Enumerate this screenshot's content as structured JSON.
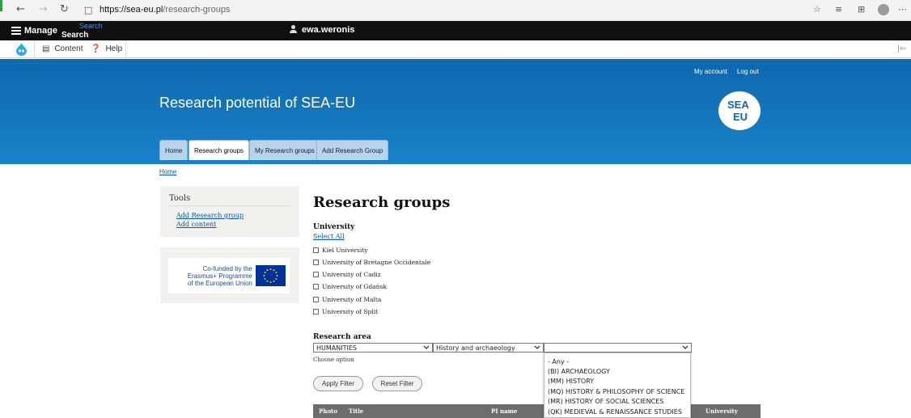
{
  "browser": {
    "back_icon": "←",
    "forward_icon": "→",
    "reload_icon": "↻",
    "page_icon": "□",
    "url_host": "https://sea-eu.pl",
    "url_path": "/research-groups",
    "right_icons": [
      "☆",
      "≡",
      "⊞",
      "⋯"
    ]
  },
  "toolbar": {
    "manage_label": "Manage",
    "search_label": "Search",
    "search_ghost": "Search",
    "username": "ewa.weronis"
  },
  "subbar": {
    "content_label": "Content",
    "help_label": "Help",
    "content_icon": "▤",
    "help_icon": "❓",
    "collapse_icon": "|⇦"
  },
  "header": {
    "my_account": "My account",
    "log_out": "Log out",
    "site_name": "Research potential of SEA-EU",
    "logo_line1": "SEA",
    "logo_line2": "EU"
  },
  "tabs": [
    {
      "label": "Home"
    },
    {
      "label": "Research groups"
    },
    {
      "label": "My Research groups"
    },
    {
      "label": "Add Research Group"
    }
  ],
  "breadcrumb": "Home",
  "sidebar": {
    "tools_title": "Tools",
    "links": [
      "Add Research group",
      "Add content"
    ],
    "erasmus_lines": [
      "Co-funded by the",
      "Erasmus+ Programme",
      "of the European Union"
    ]
  },
  "main": {
    "title": "Research groups",
    "university_label": "University",
    "select_all": "Select All",
    "universities": [
      "Kiel University",
      "University of Bretagne Occidentale",
      "University of Cadiz",
      "University of Gdańsk",
      "University of Malta",
      "University of Split"
    ],
    "research_area_label": "Research area",
    "select1_value": "HUMANITIES",
    "select2_value": "History and archaeology",
    "select3_value": "",
    "choose_option": "Choose option",
    "apply_filter": "Apply Filter",
    "reset_filter": "Reset Filter"
  },
  "dropdown_options": [
    "- Any -",
    "(BI) ARCHAEOLOGY",
    "(MM) HISTORY",
    "(MQ) HISTORY & PHILOSOPHY OF SCIENCE",
    "(MR) HISTORY OF SOCIAL SCIENCES",
    "(QK) MEDIEVAL & RENAISSANCE STUDIES"
  ],
  "table": {
    "columns": [
      "Photo",
      "Title",
      "PI name",
      "University"
    ]
  },
  "colors": {
    "header_blue": "#0d68ae",
    "link_blue": "#0b58b0",
    "toolbar_black": "#0f0f0f",
    "table_header_gray": "#6d6d6d"
  }
}
